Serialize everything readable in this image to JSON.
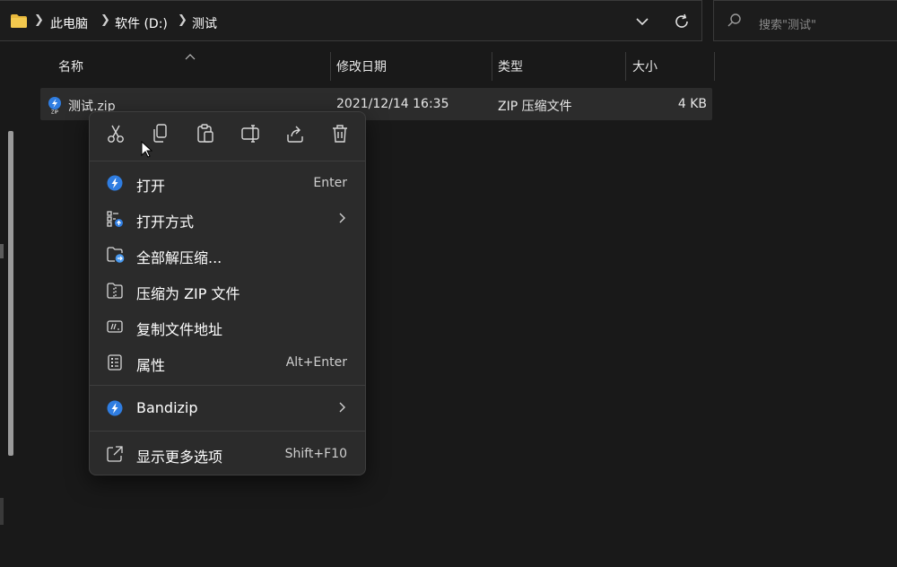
{
  "address": {
    "breadcrumbs": [
      "此电脑",
      "软件 (D:)",
      "测试"
    ],
    "search_placeholder": "搜索\"测试\""
  },
  "columns": {
    "name": "名称",
    "modified": "修改日期",
    "type": "类型",
    "size": "大小"
  },
  "file": {
    "name": "测试.zip",
    "modified": "2021/12/14 16:35",
    "type": "ZIP 压缩文件",
    "size": "4 KB"
  },
  "menu": {
    "toolbar": [
      "cut-icon",
      "copy-icon",
      "paste-icon",
      "rename-icon",
      "share-icon",
      "delete-icon"
    ],
    "items": [
      {
        "label": "打开",
        "shortcut": "Enter",
        "icon": "bandizip-icon"
      },
      {
        "label": "打开方式",
        "shortcut": "",
        "icon": "open-with-icon",
        "submenu": true
      },
      {
        "label": "全部解压缩...",
        "shortcut": "",
        "icon": "extract-all-icon"
      },
      {
        "label": "压缩为 ZIP 文件",
        "shortcut": "",
        "icon": "compress-zip-icon"
      },
      {
        "label": "复制文件地址",
        "shortcut": "",
        "icon": "copy-path-icon"
      },
      {
        "label": "属性",
        "shortcut": "Alt+Enter",
        "icon": "properties-icon"
      },
      {
        "label": "Bandizip",
        "shortcut": "",
        "icon": "bandizip-icon",
        "submenu": true
      },
      {
        "label": "显示更多选项",
        "shortcut": "Shift+F10",
        "icon": "show-more-icon"
      }
    ]
  },
  "colors": {
    "background": "#191919",
    "menu_bg": "#2b2b2b",
    "accent": "#2f7de1",
    "folder": "#e8b83c"
  }
}
